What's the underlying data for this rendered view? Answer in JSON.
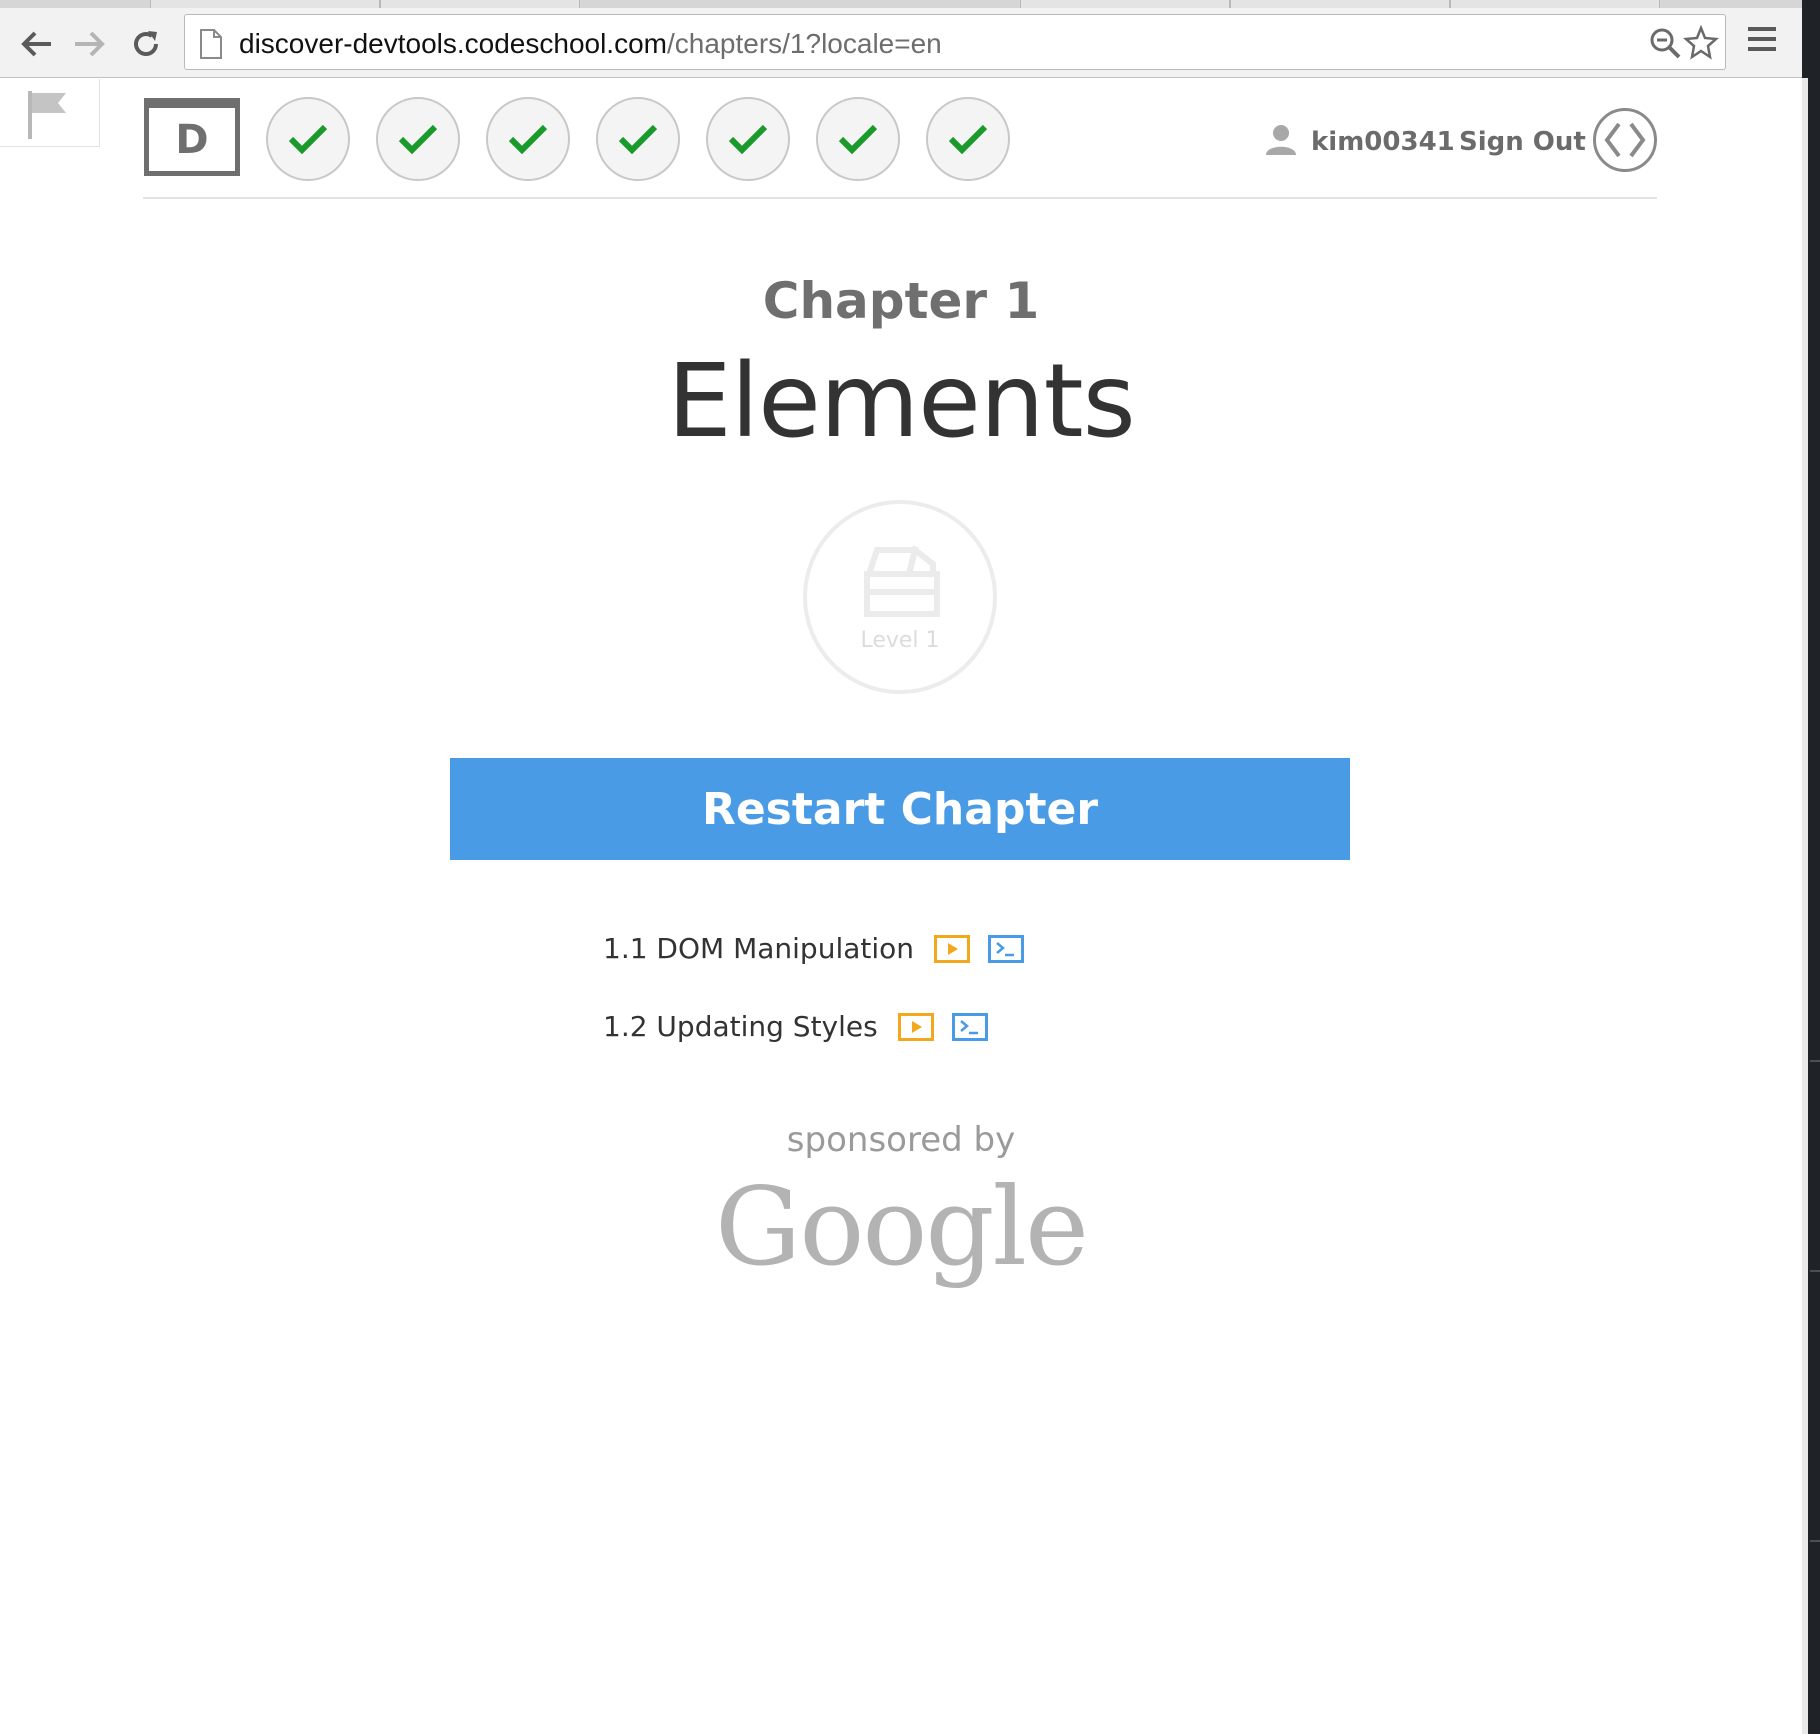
{
  "browser": {
    "url_host": "discover-devtools.codeschool.com",
    "url_path": "/chapters/1?locale=en",
    "icons": [
      "back-arrow-icon",
      "forward-arrow-icon",
      "reload-icon",
      "page-icon",
      "zoom-icon",
      "star-icon",
      "menu-icon"
    ]
  },
  "header": {
    "logo_letter": "D",
    "levels": [
      {
        "completed": true
      },
      {
        "completed": true
      },
      {
        "completed": true
      },
      {
        "completed": true
      },
      {
        "completed": true
      },
      {
        "completed": true
      },
      {
        "completed": true
      }
    ],
    "username": "kim00341",
    "sign_out": "Sign Out"
  },
  "chapter": {
    "label": "Chapter 1",
    "title": "Elements",
    "badge_text": "Level 1",
    "restart_label": "Restart Chapter",
    "lessons": [
      {
        "label": "1.1 DOM Manipulation"
      },
      {
        "label": "1.2 Updating Styles"
      }
    ]
  },
  "sponsor": {
    "text": "sponsored by",
    "logo_text": "Google"
  },
  "colors": {
    "accent": "#4a9be6",
    "check": "#1a9a2a",
    "video_icon": "#f1a81c",
    "console_icon": "#4a9be6"
  }
}
